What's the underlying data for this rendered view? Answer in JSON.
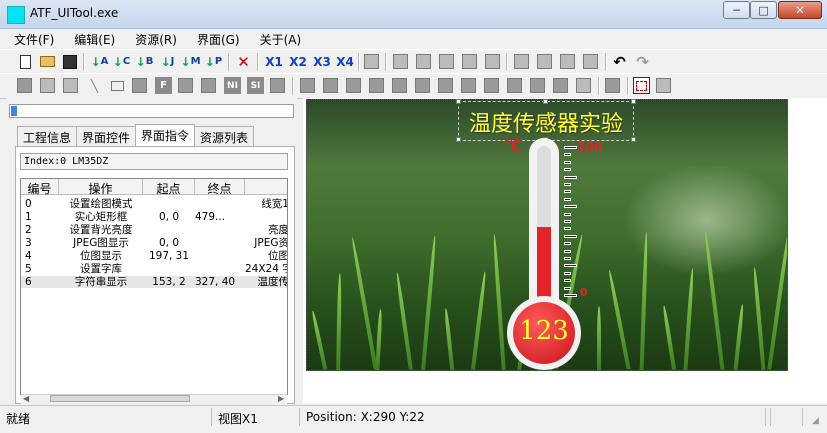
{
  "window": {
    "title": "ATF_UITool.exe",
    "min_label": "─",
    "max_label": "□",
    "close_label": "✕"
  },
  "menu": [
    "文件(F)",
    "编辑(E)",
    "资源(R)",
    "界面(G)",
    "关于(A)"
  ],
  "toolbar1": {
    "align_buttons": [
      "A",
      "C",
      "B",
      "J",
      "M",
      "P"
    ],
    "delete_label": "✕",
    "zoom_buttons": [
      "X1",
      "X2",
      "X3",
      "X4"
    ],
    "undo_label": "↶",
    "redo_label": "↷"
  },
  "toolbar2": {
    "text_buttons": [
      "F",
      "NI",
      "SI"
    ]
  },
  "left": {
    "progress_fraction": 0.02,
    "tabs": [
      "工程信息",
      "界面控件",
      "界面指令",
      "资源列表"
    ],
    "active_tab": 2,
    "index_field": "Index:0 LM35DZ",
    "columns": [
      "编号",
      "操作",
      "起点",
      "终点"
    ],
    "rows": [
      {
        "no": "0",
        "op": "设置绘图模式",
        "start": "",
        "end": "",
        "extra": "线宽1"
      },
      {
        "no": "1",
        "op": "实心矩形框",
        "start": "0, 0",
        "end": "479...",
        "extra": ""
      },
      {
        "no": "2",
        "op": "设置背光亮度",
        "start": "",
        "end": "",
        "extra": "亮度"
      },
      {
        "no": "3",
        "op": "JPEG图显示",
        "start": "0, 0",
        "end": "",
        "extra": "JPEG资"
      },
      {
        "no": "4",
        "op": "位图显示",
        "start": "197, 31",
        "end": "",
        "extra": "位图"
      },
      {
        "no": "5",
        "op": "设置字库",
        "start": "",
        "end": "",
        "extra": "24X24 字"
      },
      {
        "no": "6",
        "op": "字符串显示",
        "start": "153, 2",
        "end": "327, 40",
        "extra": "温度传"
      }
    ]
  },
  "canvas": {
    "title_text": "温度传感器实验",
    "unit": "℃",
    "max_label": "100",
    "min_label": "0",
    "value": "123",
    "fill_fraction": 0.55,
    "colors": {
      "text": "#ffff33",
      "mercury": "#e2232a"
    }
  },
  "status": {
    "ready": "就绪",
    "view": "视图X1",
    "position": "Position: X:290 Y:22"
  }
}
